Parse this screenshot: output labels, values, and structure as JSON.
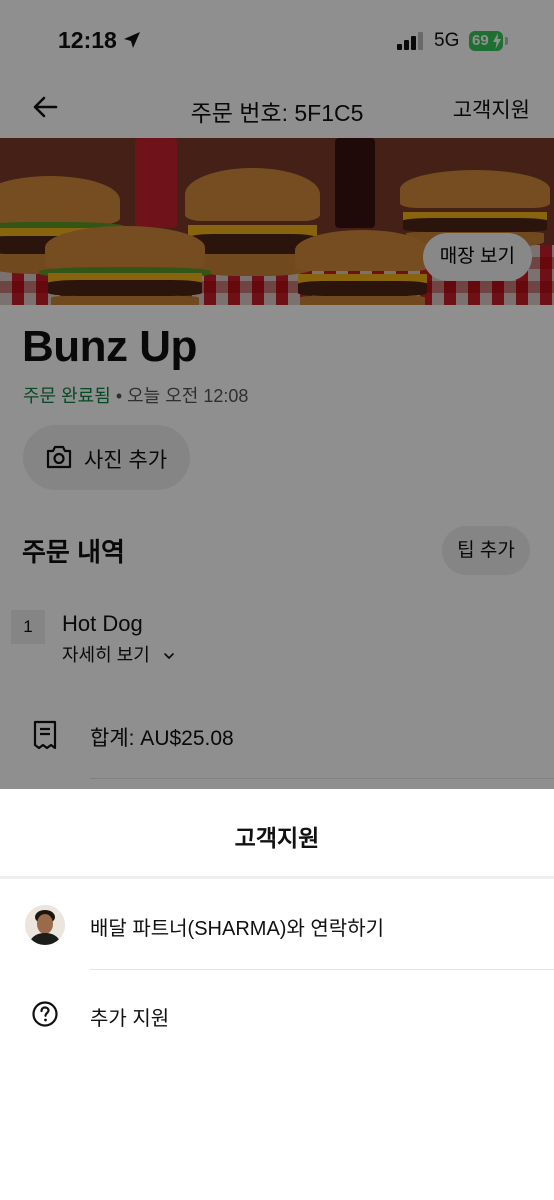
{
  "status_bar": {
    "time": "12:18",
    "network": "5G",
    "battery": "69"
  },
  "header": {
    "title": "주문 번호: 5F1C5",
    "support": "고객지원"
  },
  "hero": {
    "store_button": "매장 보기"
  },
  "restaurant": {
    "name": "Bunz Up",
    "status": "주문 완료됨",
    "separator": " • ",
    "time": "오늘 오전 12:08"
  },
  "photo_button": "사진 추가",
  "order": {
    "title": "주문 내역",
    "tip_button": "팁 추가",
    "items": [
      {
        "qty": "1",
        "name": "Hot Dog",
        "detail": "자세히 보기"
      }
    ],
    "total": "합계: AU$25.08"
  },
  "sheet": {
    "title": "고객지원",
    "options": [
      {
        "label": "배달 파트너(SHARMA)와 연락하기",
        "icon": "avatar"
      },
      {
        "label": "추가 지원",
        "icon": "help-circle-icon"
      }
    ]
  },
  "colors": {
    "accent_green": "#0e8345",
    "battery_green": "#34c759",
    "overlay": "rgba(0,0,0,0.44)"
  }
}
